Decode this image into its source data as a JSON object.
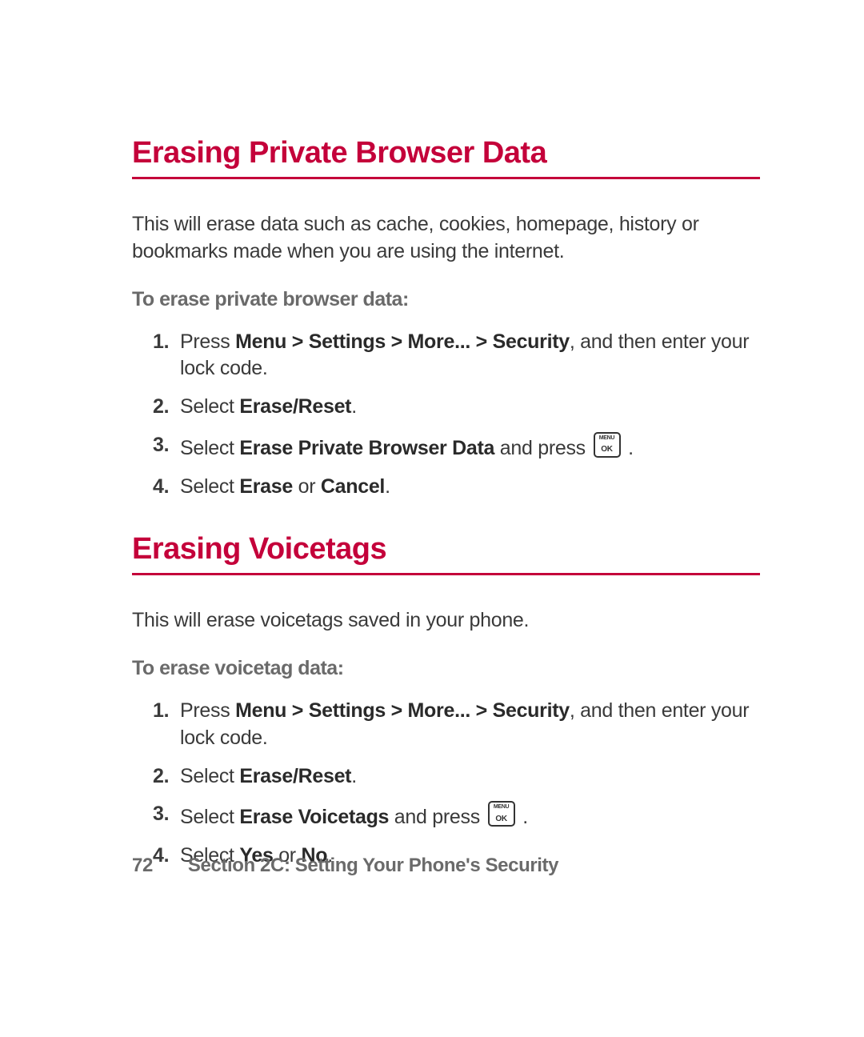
{
  "section1": {
    "heading": "Erasing Private Browser Data",
    "intro": "This will erase data such as cache, cookies, homepage, history or bookmarks made when you are using the internet.",
    "subheading": "To erase private browser data:",
    "steps": {
      "s1_pre": "Press ",
      "s1_bold": "Menu > Settings > More... > Security",
      "s1_post": ", and then enter your lock code.",
      "s2_pre": "Select ",
      "s2_bold": "Erase/Reset",
      "s2_post": ".",
      "s3_pre": "Select ",
      "s3_bold": "Erase Private Browser Data",
      "s3_mid": " and press ",
      "s3_post": " .",
      "s4_pre": "Select ",
      "s4_bold1": "Erase",
      "s4_mid": " or ",
      "s4_bold2": "Cancel",
      "s4_post": "."
    }
  },
  "section2": {
    "heading": "Erasing Voicetags",
    "intro": "This will erase voicetags saved in your phone.",
    "subheading": "To erase voicetag data:",
    "steps": {
      "s1_pre": "Press ",
      "s1_bold": "Menu > Settings > More... > Security",
      "s1_post": ", and then enter your lock code.",
      "s2_pre": "Select ",
      "s2_bold": "Erase/Reset",
      "s2_post": ".",
      "s3_pre": "Select ",
      "s3_bold": "Erase Voicetags",
      "s3_mid": " and press ",
      "s3_post": " .",
      "s4_pre": "Select ",
      "s4_bold1": "Yes",
      "s4_mid": " or ",
      "s4_bold2": "No",
      "s4_post": "."
    }
  },
  "footer": {
    "page_number": "72",
    "section_label": "Section 2C: Setting Your Phone's Security"
  }
}
